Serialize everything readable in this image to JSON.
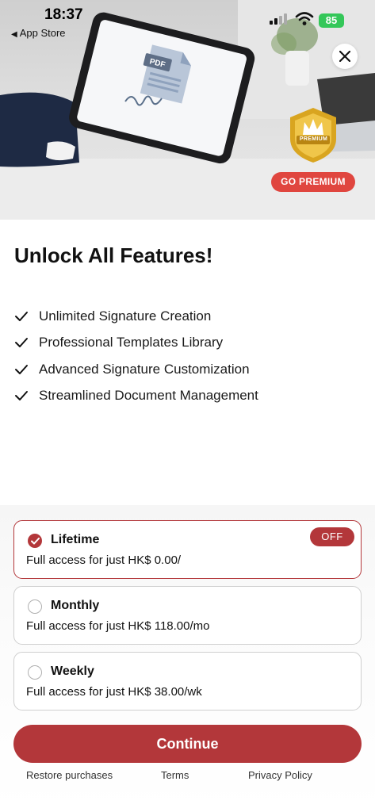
{
  "status_bar": {
    "time": "18:37",
    "back_label": "App Store",
    "battery": "85"
  },
  "hero": {
    "document_label": "PDF",
    "badge_text": "PREMIUM",
    "go_premium_label": "GO PREMIUM"
  },
  "main": {
    "headline": "Unlock All Features!",
    "features": [
      "Unlimited Signature Creation",
      "Professional Templates Library",
      "Advanced Signature Customization",
      "Streamlined Document Management"
    ]
  },
  "plans": [
    {
      "name": "Lifetime",
      "description": "Full access for just HK$ 0.00/",
      "badge": "OFF",
      "selected": true
    },
    {
      "name": "Monthly",
      "description": "Full access for just HK$ 118.00/mo",
      "selected": false
    },
    {
      "name": "Weekly",
      "description": "Full access for just HK$ 38.00/wk",
      "selected": false
    }
  ],
  "actions": {
    "continue_label": "Continue"
  },
  "footer": {
    "restore_label": "Restore purchases",
    "terms_label": "Terms",
    "privacy_label": "Privacy Policy"
  },
  "colors": {
    "brand_red": "#b3373a",
    "go_premium_red": "#e0463f",
    "battery_green": "#34c759",
    "badge_gold": "#d9a520"
  }
}
